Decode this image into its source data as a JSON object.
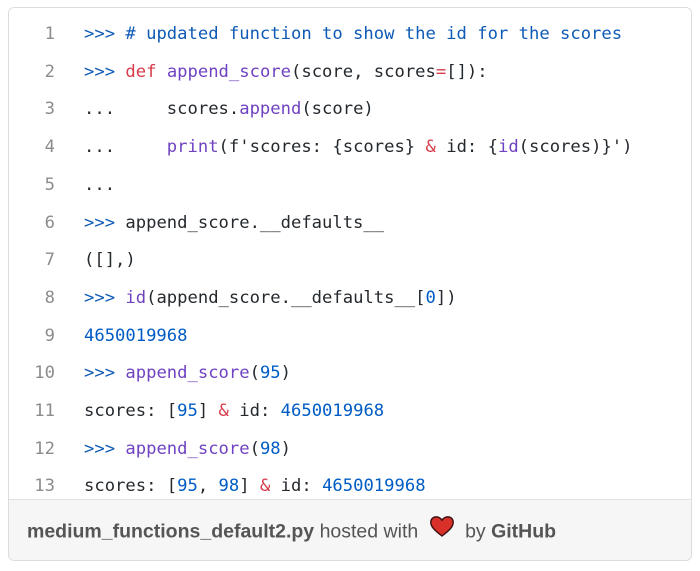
{
  "code": {
    "lines": [
      {
        "num": "1",
        "tokens": [
          {
            "t": ">>> ",
            "c": "prompt"
          },
          {
            "t": "# updated function to show the id for the scores",
            "c": "prompt"
          }
        ]
      },
      {
        "num": "2",
        "tokens": [
          {
            "t": ">>> ",
            "c": "prompt"
          },
          {
            "t": "def",
            "c": "kw"
          },
          {
            "t": " ",
            "c": "text"
          },
          {
            "t": "append_score",
            "c": "fn"
          },
          {
            "t": "(score, scores",
            "c": "text"
          },
          {
            "t": "=",
            "c": "kw"
          },
          {
            "t": "[]):",
            "c": "text"
          }
        ]
      },
      {
        "num": "3",
        "tokens": [
          {
            "t": "...     ",
            "c": "text"
          },
          {
            "t": "scores.",
            "c": "text"
          },
          {
            "t": "append",
            "c": "fn"
          },
          {
            "t": "(score)",
            "c": "text"
          }
        ]
      },
      {
        "num": "4",
        "tokens": [
          {
            "t": "...     ",
            "c": "text"
          },
          {
            "t": "print",
            "c": "fn"
          },
          {
            "t": "(f'scores: {scores} ",
            "c": "text"
          },
          {
            "t": "&",
            "c": "kw"
          },
          {
            "t": " id: {",
            "c": "text"
          },
          {
            "t": "id",
            "c": "fn"
          },
          {
            "t": "(scores)}')",
            "c": "text"
          }
        ]
      },
      {
        "num": "5",
        "tokens": [
          {
            "t": "...",
            "c": "text"
          }
        ]
      },
      {
        "num": "6",
        "tokens": [
          {
            "t": ">>> ",
            "c": "prompt"
          },
          {
            "t": "append_score.__defaults__",
            "c": "text"
          }
        ]
      },
      {
        "num": "7",
        "tokens": [
          {
            "t": "([],)",
            "c": "text"
          }
        ]
      },
      {
        "num": "8",
        "tokens": [
          {
            "t": ">>> ",
            "c": "prompt"
          },
          {
            "t": "id",
            "c": "fn"
          },
          {
            "t": "(append_score.__defaults__[",
            "c": "text"
          },
          {
            "t": "0",
            "c": "num"
          },
          {
            "t": "])",
            "c": "text"
          }
        ]
      },
      {
        "num": "9",
        "tokens": [
          {
            "t": "4650019968",
            "c": "num"
          }
        ]
      },
      {
        "num": "10",
        "tokens": [
          {
            "t": ">>> ",
            "c": "prompt"
          },
          {
            "t": "append_score",
            "c": "fn"
          },
          {
            "t": "(",
            "c": "text"
          },
          {
            "t": "95",
            "c": "num"
          },
          {
            "t": ")",
            "c": "text"
          }
        ]
      },
      {
        "num": "11",
        "tokens": [
          {
            "t": "scores: [",
            "c": "text"
          },
          {
            "t": "95",
            "c": "num"
          },
          {
            "t": "] ",
            "c": "text"
          },
          {
            "t": "&",
            "c": "kw"
          },
          {
            "t": " id: ",
            "c": "text"
          },
          {
            "t": "4650019968",
            "c": "num"
          }
        ]
      },
      {
        "num": "12",
        "tokens": [
          {
            "t": ">>> ",
            "c": "prompt"
          },
          {
            "t": "append_score",
            "c": "fn"
          },
          {
            "t": "(",
            "c": "text"
          },
          {
            "t": "98",
            "c": "num"
          },
          {
            "t": ")",
            "c": "text"
          }
        ]
      },
      {
        "num": "13",
        "tokens": [
          {
            "t": "scores: [",
            "c": "text"
          },
          {
            "t": "95",
            "c": "num"
          },
          {
            "t": ", ",
            "c": "text"
          },
          {
            "t": "98",
            "c": "num"
          },
          {
            "t": "] ",
            "c": "text"
          },
          {
            "t": "&",
            "c": "kw"
          },
          {
            "t": " id: ",
            "c": "text"
          },
          {
            "t": "4650019968",
            "c": "num"
          }
        ]
      }
    ]
  },
  "footer": {
    "filename": "medium_functions_default2.py",
    "hosted_with": "hosted with",
    "by": "by",
    "brand": "GitHub",
    "heart_icon": "heart-icon",
    "heart_color": "#d9302a"
  },
  "colors": {
    "prompt": "#0e5ab5",
    "keyword": "#d73a49",
    "function": "#6f42c1",
    "number": "#005cc5",
    "text": "#24292e",
    "line_number": "#8c8c8c",
    "footer_bg": "#f6f6f6"
  }
}
